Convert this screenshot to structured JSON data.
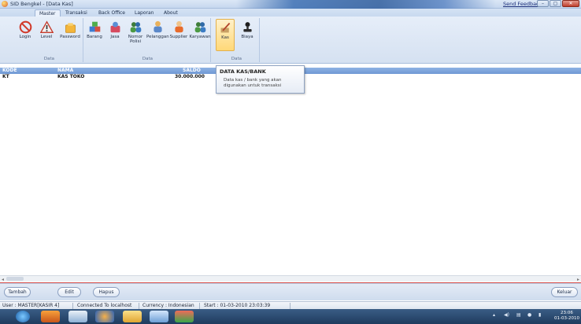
{
  "window": {
    "title": "SID Bengkel - [Data Kas]",
    "feedback_link": "Send Feedback",
    "minimize": "–",
    "maximize": "▢",
    "close": "✕"
  },
  "menu_tabs": [
    "Master",
    "Transaksi",
    "Back Office",
    "Laporan",
    "About"
  ],
  "ribbon": {
    "groups": [
      {
        "title": "Data",
        "buttons": [
          {
            "label": "Login",
            "icon": "no-entry-icon"
          },
          {
            "label": "Level",
            "icon": "warning-triangle-icon"
          },
          {
            "label": "Password",
            "icon": "key-folder-icon"
          }
        ]
      },
      {
        "title": "Data",
        "buttons": [
          {
            "label": "Barang",
            "icon": "boxes-icon"
          },
          {
            "label": "Jasa",
            "icon": "service-icon"
          },
          {
            "label": "Nomor Polisi",
            "icon": "people-icon"
          },
          {
            "label": "Pelanggan",
            "icon": "customer-icon"
          },
          {
            "label": "Supplier",
            "icon": "supplier-icon"
          },
          {
            "label": "Karyawan",
            "icon": "employees-icon"
          }
        ]
      },
      {
        "title": "Data",
        "buttons": [
          {
            "label": "Kas",
            "icon": "cash-pen-icon"
          },
          {
            "label": "Biaya",
            "icon": "cost-stamp-icon"
          }
        ]
      }
    ]
  },
  "grid": {
    "columns": [
      "KODE",
      "NAMA",
      "SALDO"
    ],
    "rows": [
      {
        "kode": "KT",
        "nama": "KAS TOKO",
        "saldo": "30.000.000"
      }
    ]
  },
  "tooltip": {
    "title": "DATA KAS/BANK",
    "body": "Data kas / bank yang akan digunakan untuk transaksi"
  },
  "footer_buttons": {
    "add": "Tambah",
    "edit": "Edit",
    "delete": "Hapus",
    "exit": "Keluar"
  },
  "status": {
    "user": "User : MASTER[KASIR 4]",
    "connection": "Connected To localhost",
    "currency": "Currency : Indonesian",
    "start": "Start : 01-03-2010 23:03:39"
  },
  "taskbar": {
    "time": "23:06",
    "date": "01-03-2010"
  },
  "colors": {
    "grid_header": "#7aa0d8",
    "ribbon_bg": "#dde7f4",
    "highlight": "#ffd878",
    "separator_red": "#d9534f"
  }
}
